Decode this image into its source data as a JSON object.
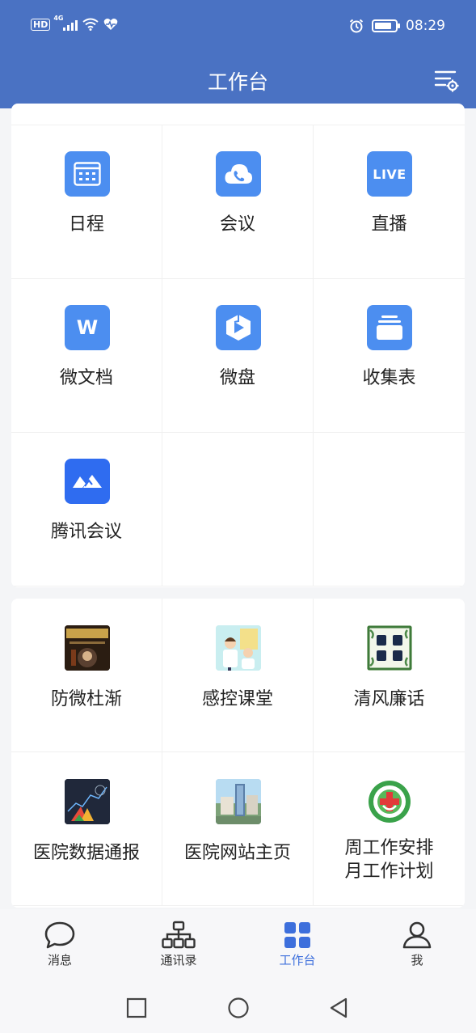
{
  "status_bar": {
    "hd": "HD",
    "network": "4G",
    "time": "08:29",
    "battery_level": 0.85
  },
  "header": {
    "title": "工作台",
    "settings_icon": "settings-list-icon"
  },
  "apps": [
    {
      "label": "日程",
      "icon": "calendar-icon",
      "color": "#4c8ef0"
    },
    {
      "label": "会议",
      "icon": "meeting-cloud-phone-icon",
      "color": "#4c8ef0"
    },
    {
      "label": "直播",
      "icon": "live-icon",
      "icon_text": "LIVE",
      "color": "#4c8ef0"
    },
    {
      "label": "微文档",
      "icon": "doc-w-icon",
      "icon_text": "W",
      "color": "#4c8ef0"
    },
    {
      "label": "微盘",
      "icon": "drive-icon",
      "color": "#4c8ef0"
    },
    {
      "label": "收集表",
      "icon": "form-collect-icon",
      "color": "#4c8ef0"
    },
    {
      "label": "腾讯会议",
      "icon": "tencent-meeting-icon",
      "color": "#2f6cf0"
    }
  ],
  "custom_apps": [
    {
      "label": "防微杜渐",
      "icon": "fire-safety-thumbnail-icon"
    },
    {
      "label": "感控课堂",
      "icon": "infection-control-thumbnail-icon"
    },
    {
      "label": "清风廉话",
      "icon": "integrity-talk-thumbnail-icon"
    },
    {
      "label": "医院数据通报",
      "icon": "hospital-data-thumbnail-icon"
    },
    {
      "label": "医院网站主页",
      "icon": "hospital-website-thumbnail-icon"
    },
    {
      "label": "周工作安排 月工作计划",
      "label_line1": "周工作安排",
      "label_line2": "月工作计划",
      "icon": "hospital-logo-icon"
    }
  ],
  "tabs": [
    {
      "label": "消息",
      "icon": "chat-bubble-icon",
      "active": false
    },
    {
      "label": "通讯录",
      "icon": "org-chart-icon",
      "active": false
    },
    {
      "label": "工作台",
      "icon": "grid-four-icon",
      "active": true
    },
    {
      "label": "我",
      "icon": "person-icon",
      "active": false
    }
  ],
  "colors": {
    "brand": "#4a72c3",
    "accent": "#3d6fdc",
    "app_icon": "#4c8ef0"
  }
}
